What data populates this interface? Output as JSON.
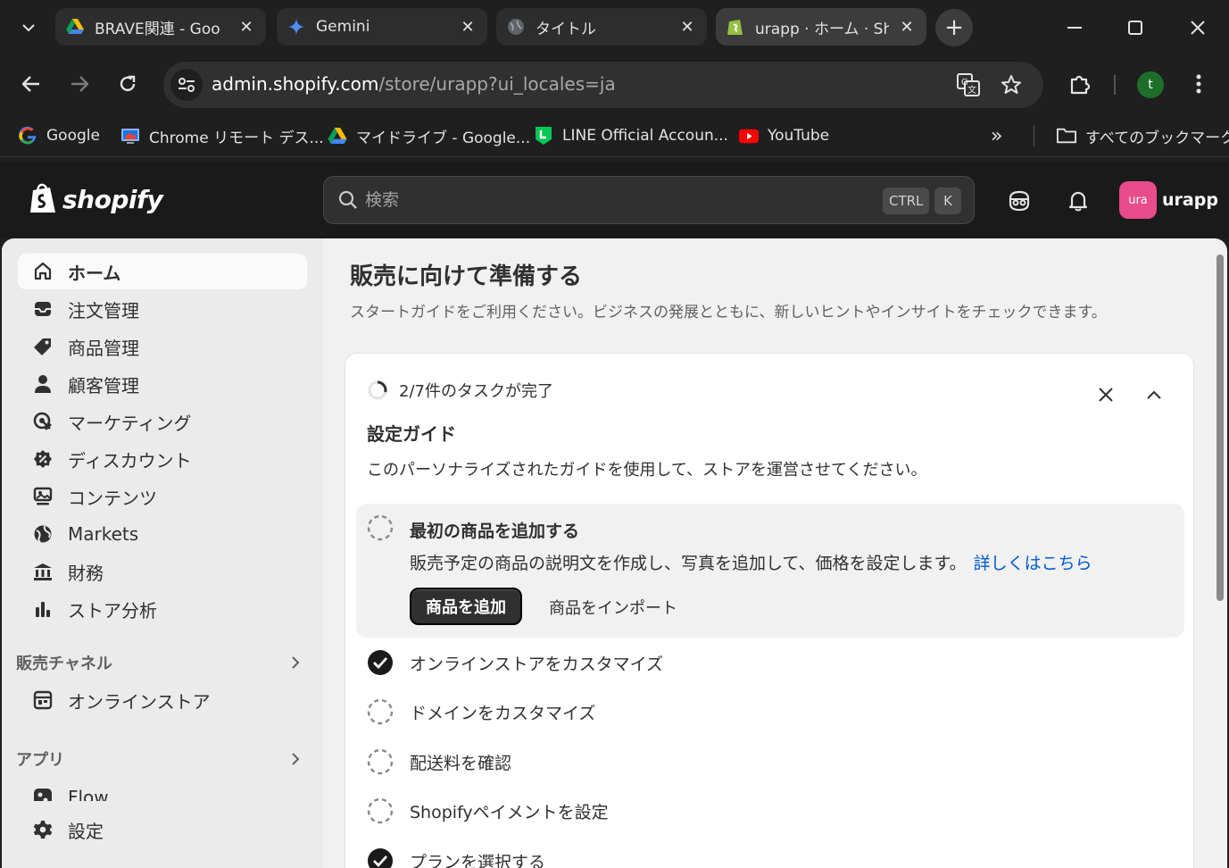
{
  "browser": {
    "tabs": [
      {
        "title": "BRAVE関連 - Goo",
        "favicon": "google-drive-icon"
      },
      {
        "title": "Gemini",
        "favicon": "gemini-icon"
      },
      {
        "title": "タイトル",
        "favicon": "globe-icon"
      },
      {
        "title": "urapp · ホーム · Sho",
        "favicon": "shopify-icon"
      }
    ],
    "url_host": "admin.shopify.com",
    "url_path": "/store/urapp?ui_locales=ja",
    "profile_initial": "t",
    "bookmarks": [
      {
        "label": "Google",
        "icon": "google-icon"
      },
      {
        "label": "Chrome リモート デス...",
        "icon": "chrome-remote-icon"
      },
      {
        "label": "マイドライブ - Google...",
        "icon": "google-drive-icon"
      },
      {
        "label": "LINE Official Accoun...",
        "icon": "line-icon"
      },
      {
        "label": "YouTube",
        "icon": "youtube-icon"
      }
    ],
    "bookmarks_more": "»",
    "all_bookmarks": "すべてのブックマーク"
  },
  "shopify": {
    "logo_text": "shopify",
    "search_placeholder": "検索",
    "shortcut_ctrl": "CTRL",
    "shortcut_k": "K",
    "store_avatar": "ura",
    "store_name": "urapp"
  },
  "sidebar": {
    "items": [
      {
        "label": "ホーム",
        "icon": "home-icon"
      },
      {
        "label": "注文管理",
        "icon": "inbox-icon"
      },
      {
        "label": "商品管理",
        "icon": "tag-icon"
      },
      {
        "label": "顧客管理",
        "icon": "person-icon"
      },
      {
        "label": "マーケティング",
        "icon": "target-icon"
      },
      {
        "label": "ディスカウント",
        "icon": "discount-icon"
      },
      {
        "label": "コンテンツ",
        "icon": "image-icon"
      },
      {
        "label": "Markets",
        "icon": "globe-icon"
      },
      {
        "label": "財務",
        "icon": "bank-icon"
      },
      {
        "label": "ストア分析",
        "icon": "bar-chart-icon"
      }
    ],
    "sales_channels_label": "販売チャネル",
    "online_store": "オンラインストア",
    "apps_label": "アプリ",
    "flow": "Flow",
    "settings": "設定"
  },
  "main": {
    "title": "販売に向けて準備する",
    "subtitle": "スタートガイドをご利用ください。ビジネスの発展とともに、新しいヒントやインサイトをチェックできます。",
    "progress_text": "2/7件のタスクが完了",
    "progress_done": 2,
    "progress_total": 7,
    "guide_title": "設定ガイド",
    "guide_desc": "このパーソナライズされたガイドを使用して、ストアを運営させてください。",
    "active_task": {
      "title": "最初の商品を追加する",
      "desc": "販売予定の商品の説明文を作成し、写真を追加して、価格を設定します。",
      "link": "詳しくはこちら",
      "primary_button": "商品を追加",
      "secondary_button": "商品をインポート"
    },
    "tasks": [
      {
        "label": "オンラインストアをカスタマイズ",
        "done": true
      },
      {
        "label": "ドメインをカスタマイズ",
        "done": false
      },
      {
        "label": "配送料を確認",
        "done": false
      },
      {
        "label": "Shopifyペイメントを設定",
        "done": false
      },
      {
        "label": "プランを選択する",
        "done": true
      }
    ]
  },
  "colors": {
    "shopify_topbar": "#1a1a1a",
    "link": "#005bd3",
    "store_avatar": "#e94c8a",
    "profile": "#1e6e2a"
  }
}
